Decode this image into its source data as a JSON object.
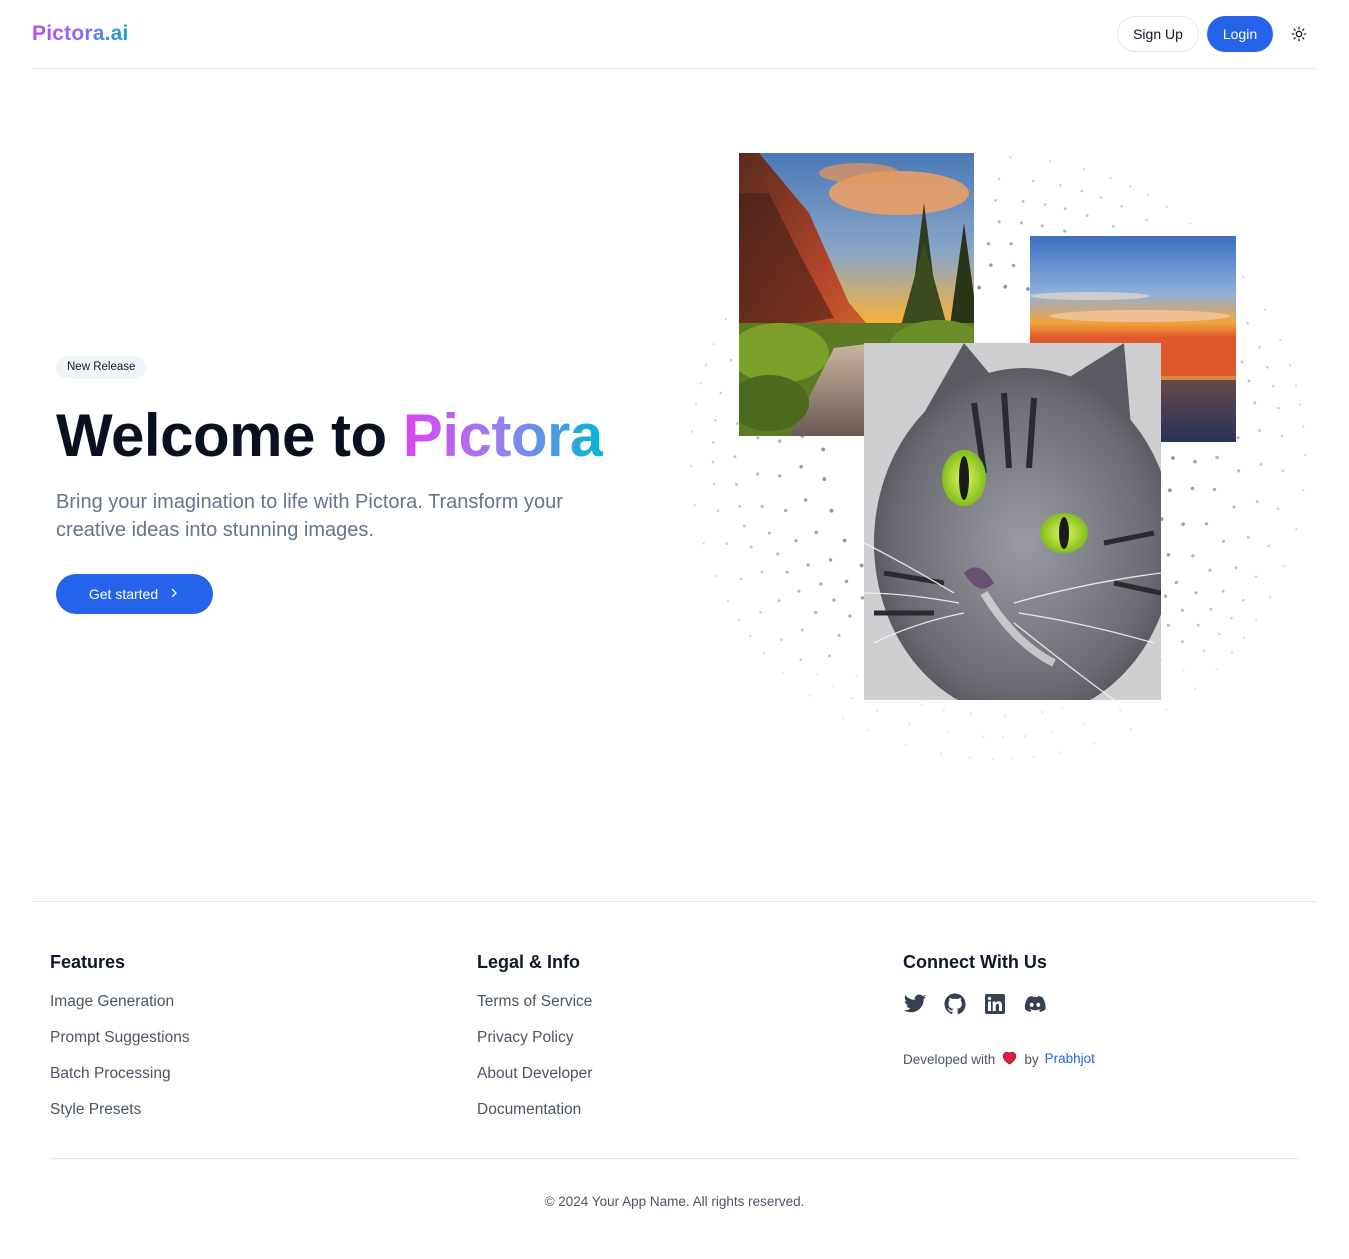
{
  "header": {
    "logo": "Pictora.ai",
    "signup_label": "Sign Up",
    "login_label": "Login",
    "theme_icon": "sun-icon"
  },
  "hero": {
    "badge": "New Release",
    "title_plain": "Welcome to ",
    "title_highlight": "Pictora",
    "subtitle": "Bring your imagination to life with Pictora. Transform your creative ideas into stunning images.",
    "cta_label": "Get started",
    "cta_icon": "chevron-right-icon",
    "images": [
      "mountain-river-sunset-image",
      "ocean-sunset-image",
      "tabby-cat-image"
    ]
  },
  "footer": {
    "features": {
      "heading": "Features",
      "links": [
        "Image Generation",
        "Prompt Suggestions",
        "Batch Processing",
        "Style Presets"
      ]
    },
    "legal": {
      "heading": "Legal & Info",
      "links": [
        "Terms of Service",
        "Privacy Policy",
        "About Developer",
        "Documentation"
      ]
    },
    "connect": {
      "heading": "Connect With Us",
      "social_icons": [
        "twitter-icon",
        "github-icon",
        "linkedin-icon",
        "discord-icon"
      ],
      "dev_prefix": "Developed with",
      "dev_by": "by",
      "dev_name": "Prabhjot"
    },
    "copyright": "© 2024 Your App Name. All rights reserved."
  },
  "colors": {
    "primary": "#2563eb",
    "gradient_start": "#d946ef",
    "gradient_end": "#06b6d4",
    "heart": "#e11d48"
  }
}
